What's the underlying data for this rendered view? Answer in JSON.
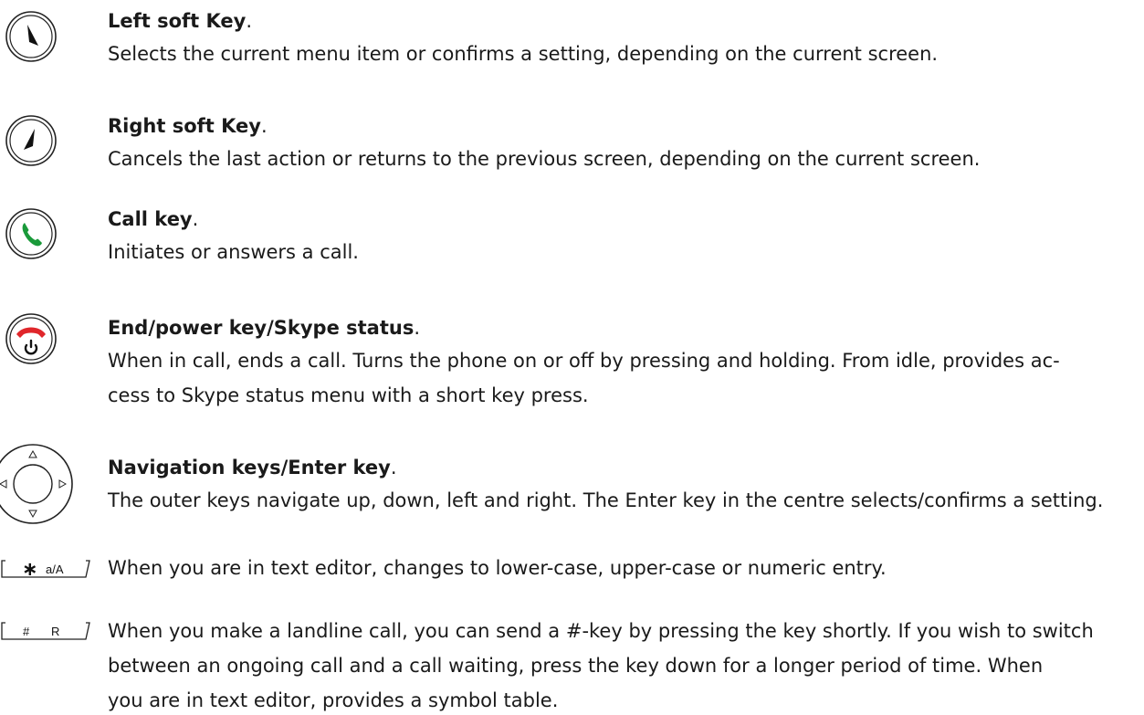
{
  "entries": [
    {
      "id": "left-soft-key",
      "title": "Left soft Key",
      "punct": ".",
      "desc": "Selects the current menu item or confirms a setting, depending on the current screen."
    },
    {
      "id": "right-soft-key",
      "title": "Right soft Key",
      "punct": ".",
      "desc": "Cancels the last action or returns to the previous screen, depending on the current screen."
    },
    {
      "id": "call-key",
      "title": "Call key",
      "punct": ".",
      "desc": "Initiates or answers a call."
    },
    {
      "id": "end-power-key",
      "title": "End/power key/Skype status",
      "punct": ".",
      "desc_line1": "When in call, ends a call. Turns the phone on or off by pressing and holding. From idle, provides ac-",
      "desc_line2": "cess to Skype status menu with a short key press."
    },
    {
      "id": "navigation-keys",
      "title": "Navigation keys/Enter key",
      "punct": ".",
      "desc": "The outer keys navigate up, down, left and right. The Enter key in the centre selects/confirms a setting."
    },
    {
      "id": "star-key",
      "key_symbol": "∗",
      "key_label": "a/A",
      "desc": "When you are in text editor, changes to lower-case, upper-case or numeric entry."
    },
    {
      "id": "hash-key",
      "key_symbol": "#",
      "key_label": "R",
      "desc_line1": "When you make a landline call, you can send a #-key by pressing the key shortly. If you wish to switch",
      "desc_line2": "between an ongoing call and a call waiting, press the key down for a longer period of time. When",
      "desc_line3": "you are in text editor, provides a symbol table."
    }
  ],
  "colors": {
    "call_green": "#1a9a3a",
    "end_red": "#e0262b",
    "text": "#1a1a1a"
  }
}
